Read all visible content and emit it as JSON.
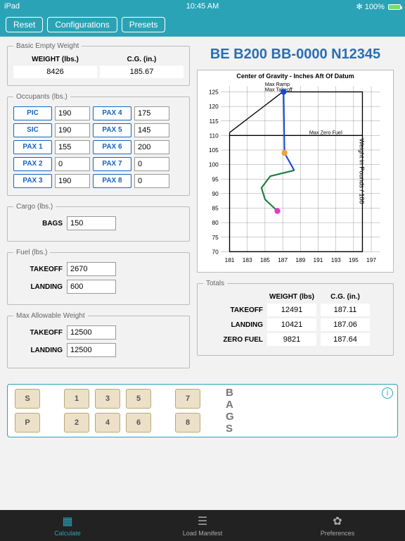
{
  "status": {
    "device": "iPad",
    "time": "10:45 AM",
    "bt": "✻",
    "battery": "100%"
  },
  "toolbar": {
    "reset": "Reset",
    "config": "Configurations",
    "presets": "Presets"
  },
  "aircraft_title": "BE B200 BB-0000 N12345",
  "bew": {
    "legend": "Basic  Empty Weight",
    "h1": "WEIGHT (lbs.)",
    "h2": "C.G. (in.)",
    "weight": "8426",
    "cg": "185.67"
  },
  "occ": {
    "legend": "Occupants (lbs.)",
    "rows": [
      {
        "l1": "PIC",
        "v1": "190",
        "l2": "PAX 4",
        "v2": "175"
      },
      {
        "l1": "SIC",
        "v1": "190",
        "l2": "PAX 5",
        "v2": "145"
      },
      {
        "l1": "PAX 1",
        "v1": "155",
        "l2": "PAX 6",
        "v2": "200"
      },
      {
        "l1": "PAX 2",
        "v1": "0",
        "l2": "PAX 7",
        "v2": "0"
      },
      {
        "l1": "PAX 3",
        "v1": "190",
        "l2": "PAX 8",
        "v2": "0"
      }
    ]
  },
  "cargo": {
    "legend": "Cargo (lbs.)",
    "label": "BAGS",
    "value": "150"
  },
  "fuel": {
    "legend": "Fuel (lbs.)",
    "takeoff_l": "TAKEOFF",
    "takeoff_v": "2670",
    "landing_l": "LANDING",
    "landing_v": "600"
  },
  "maxw": {
    "legend": "Max Allowable Weight",
    "takeoff_l": "TAKEOFF",
    "takeoff_v": "12500",
    "landing_l": "LANDING",
    "landing_v": "12500"
  },
  "chart": {
    "title": "Center of Gravity - Inches Aft Of Datum",
    "maxramp": "Max Ramp",
    "maxto": "Max Takeoff",
    "maxzf": "Max Zero Fuel",
    "ysidelabel": "Weight in Pounds / 100"
  },
  "chart_data": {
    "type": "line",
    "xlabel": "CG (inches aft of datum)",
    "ylabel": "Weight / 100 lbs",
    "xlim": [
      180,
      198
    ],
    "ylim": [
      70,
      127
    ],
    "xticks": [
      181,
      183,
      185,
      187,
      189,
      191,
      193,
      195,
      197
    ],
    "yticks": [
      70,
      75,
      80,
      85,
      90,
      95,
      100,
      105,
      110,
      115,
      120,
      125
    ],
    "envelope": [
      {
        "x": 181,
        "y": 111
      },
      {
        "x": 181,
        "y": 70
      },
      {
        "x": 196,
        "y": 70
      },
      {
        "x": 196,
        "y": 125
      },
      {
        "x": 187,
        "y": 125
      },
      {
        "x": 181,
        "y": 111
      }
    ],
    "max_zero_fuel_y": 110,
    "series": [
      {
        "name": "fuel-burn",
        "color": "#1a7d3a",
        "points": [
          {
            "x": 186.4,
            "y": 84
          },
          {
            "x": 185.0,
            "y": 88
          },
          {
            "x": 184.6,
            "y": 92
          },
          {
            "x": 185.6,
            "y": 96
          },
          {
            "x": 188.3,
            "y": 98
          }
        ]
      },
      {
        "name": "loading",
        "color": "#1548d6",
        "points": [
          {
            "x": 188.3,
            "y": 98
          },
          {
            "x": 187.2,
            "y": 104
          },
          {
            "x": 187.1,
            "y": 125
          }
        ]
      }
    ],
    "markers": [
      {
        "name": "zero-fuel",
        "x": 186.4,
        "y": 84,
        "color": "#e339c9"
      },
      {
        "name": "landing",
        "x": 187.2,
        "y": 104,
        "color": "#f2a23a"
      },
      {
        "name": "takeoff",
        "x": 187.1,
        "y": 125,
        "color": "#1548d6"
      }
    ]
  },
  "totals": {
    "legend": "Totals",
    "h1": "WEIGHT (lbs)",
    "h2": "C.G. (in.)",
    "rows": [
      {
        "l": "TAKEOFF",
        "w": "12491",
        "c": "187.11"
      },
      {
        "l": "LANDING",
        "w": "10421",
        "c": "187.06"
      },
      {
        "l": "ZERO FUEL",
        "w": "9821",
        "c": "187.64"
      }
    ]
  },
  "seats": {
    "s": "S",
    "p": "P",
    "n1": "1",
    "n2": "2",
    "n3": "3",
    "n4": "4",
    "n5": "5",
    "n6": "6",
    "n7": "7",
    "n8": "8",
    "bags": "BAGS"
  },
  "tabs": {
    "calc": "Calculate",
    "manifest": "Load Manifest",
    "prefs": "Preferences"
  }
}
